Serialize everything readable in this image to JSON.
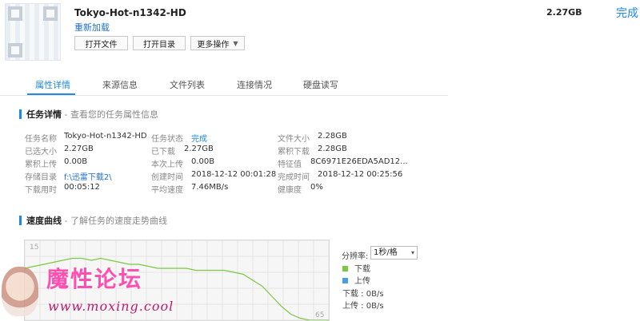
{
  "header": {
    "title": "Tokyo-Hot-n1342-HD",
    "reload": "重新加载",
    "size": "2.27GB",
    "done": "完成",
    "buttons": {
      "open_file": "打开文件",
      "open_dir": "打开目录",
      "more": "更多操作"
    }
  },
  "tabs": [
    "属性详情",
    "来源信息",
    "文件列表",
    "连接情况",
    "硬盘读写"
  ],
  "task_details": {
    "title": "任务详情",
    "subtitle": "- 查看您的任务属性信息",
    "fields": {
      "name_label": "任务名称",
      "name_value": "Tokyo-Hot-n1342-HD",
      "selected_label": "已选大小",
      "selected_value": "2.27GB",
      "total_upload_label": "累积上传",
      "total_upload_value": "0.00B",
      "storage_label": "存储目录",
      "storage_value": "f:\\迅雷下载2\\",
      "time_used_label": "下载用时",
      "time_used_value": "00:05:12",
      "status_label": "任务状态",
      "status_value": "完成",
      "downloaded_label": "已下载",
      "downloaded_value": "2.27GB",
      "this_upload_label": "本次上传",
      "this_upload_value": "0.00B",
      "created_label": "创建时间",
      "created_value": "2018-12-12 00:01:28",
      "avg_speed_label": "平均速度",
      "avg_speed_value": "7.46MB/s",
      "file_size_label": "文件大小",
      "file_size_value": "2.28GB",
      "total_dl_label": "累积下载",
      "total_dl_value": "2.28GB",
      "hash_label": "特征值",
      "hash_value": "8C6971E26EDA5AD12...",
      "finished_label": "完成时间",
      "finished_value": "2018-12-12 00:25:56",
      "health_label": "健康度",
      "health_value": "0%"
    }
  },
  "speed_curve": {
    "title": "速度曲线",
    "subtitle": "- 了解任务的速度走势曲线",
    "resolution_label": "分辨率:",
    "resolution_value": "1秒/格",
    "legend_download": "下载",
    "legend_upload": "上传",
    "download_rate": "下载 : 0B/s",
    "upload_rate": "上传 : 0B/s",
    "axis_top": "15",
    "axis_bottom_right": "65",
    "colors": {
      "download": "#7ac943",
      "upload": "#4a9fe0"
    },
    "download_series": [
      2.6,
      2.7,
      2.8,
      2.9,
      3.0,
      3.1,
      3.1,
      3.0,
      3.1,
      3.0,
      2.9,
      2.8,
      2.8,
      2.7,
      2.6,
      2.6,
      2.6,
      2.6,
      2.5,
      2.5,
      2.5,
      2.5,
      2.4,
      2.3,
      2.0,
      1.7,
      1.2,
      0.7,
      0.3,
      0.1,
      0.0,
      0.0,
      0.0
    ]
  },
  "watermark": {
    "text": "魔性论坛",
    "url": "www.moxing.cool"
  }
}
